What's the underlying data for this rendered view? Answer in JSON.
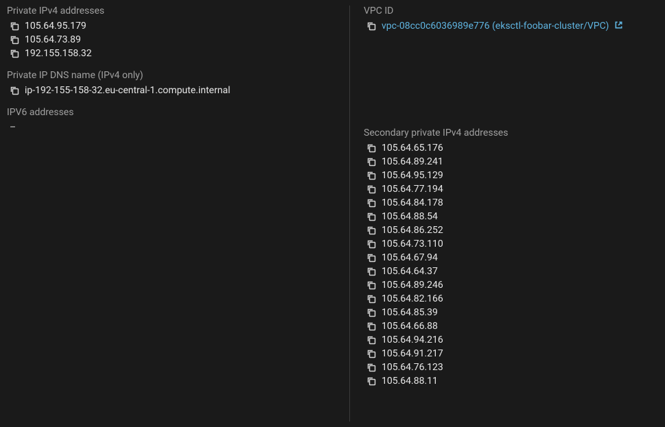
{
  "left": {
    "private_ipv4": {
      "label": "Private IPv4 addresses",
      "items": [
        "105.64.95.179",
        "105.64.73.89",
        "192.155.158.32"
      ]
    },
    "private_dns": {
      "label": "Private IP DNS name (IPv4 only)",
      "value": "ip-192-155-158-32.eu-central-1.compute.internal"
    },
    "ipv6": {
      "label": "IPV6 addresses",
      "value": "–"
    }
  },
  "right": {
    "vpc": {
      "label": "VPC ID",
      "value": "vpc-08cc0c6036989e776 (eksctl-foobar-cluster/VPC)"
    },
    "secondary_ipv4": {
      "label": "Secondary private IPv4 addresses",
      "items": [
        "105.64.65.176",
        "105.64.89.241",
        "105.64.95.129",
        "105.64.77.194",
        "105.64.84.178",
        "105.64.88.54",
        "105.64.86.252",
        "105.64.73.110",
        "105.64.67.94",
        "105.64.64.37",
        "105.64.89.246",
        "105.64.82.166",
        "105.64.85.39",
        "105.64.66.88",
        "105.64.94.216",
        "105.64.91.217",
        "105.64.76.123",
        "105.64.88.11"
      ]
    }
  }
}
